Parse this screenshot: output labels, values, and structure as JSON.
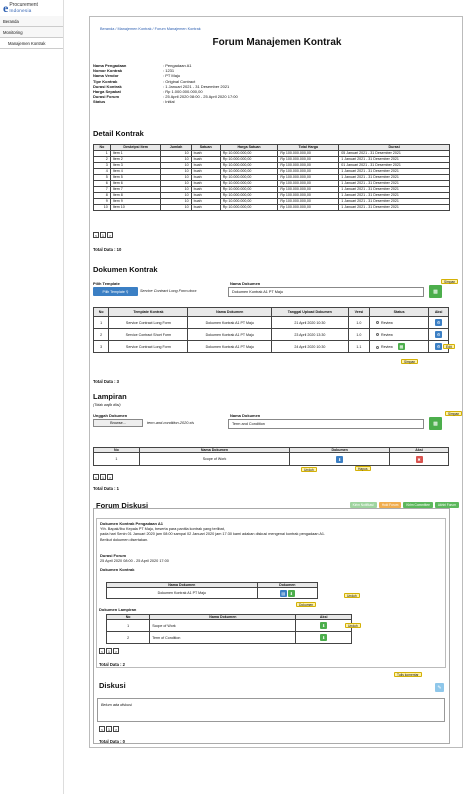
{
  "logo": {
    "mark": "e",
    "line1": "Procurement",
    "line2": "Indonesia"
  },
  "nav": [
    "Beranda",
    "Monitoring",
    "Manajemen Kontrak"
  ],
  "breadcrumb": "Beranda / Manajemen Kontrak / Forum Manajemen Kontrak",
  "page_title": "Forum Manajemen Kontrak",
  "info": [
    {
      "k": "Nama Pengadaan",
      "v": ": Pengadaan A1"
    },
    {
      "k": "Nomor Kontrak",
      "v": ": 1231"
    },
    {
      "k": "Nama Vendor",
      "v": ": PT Maju"
    },
    {
      "k": "Tipe Kontrak",
      "v": ": Original Contract"
    },
    {
      "k": "Durasi Kontrak",
      "v": ": 1 Januari 2021 - 31 Desember 2021"
    },
    {
      "k": "Harga Sepakat",
      "v": ": Rp 1.000.000.000,00"
    },
    {
      "k": "Durasi Forum",
      "v": ": 25 April 2020 08:00 - 25 April 2020 17:00"
    },
    {
      "k": "Status",
      "v": ": Initial"
    }
  ],
  "detail": {
    "title": "Detail Kontrak",
    "headers": [
      "No",
      "Deskripsi Item",
      "Jumlah",
      "Satuan",
      "Harga Satuan",
      "Total Harga",
      "Durasi"
    ],
    "rows": [
      [
        "1",
        "Item 1",
        "10",
        "buah",
        "Rp 10.000.000,00",
        "Rp 100.000.000,00",
        "05 Januari 2021 - 31 Desember 2021"
      ],
      [
        "2",
        "Item 2",
        "10",
        "buah",
        "Rp 10.000.000,00",
        "Rp 100.000.000,00",
        "1 Januari 2021 - 31 Desember 2021"
      ],
      [
        "3",
        "Item 3",
        "10",
        "buah",
        "Rp 10.000.000,00",
        "Rp 100.000.000,00",
        "01 Januari 2021 - 31 Desember 2021"
      ],
      [
        "4",
        "Item 4",
        "10",
        "buah",
        "Rp 10.000.000,00",
        "Rp 100.000.000,00",
        "1 Januari 2021 - 31 Desember 2021"
      ],
      [
        "5",
        "Item 5",
        "10",
        "buah",
        "Rp 10.000.000,00",
        "Rp 100.000.000,00",
        "1 Januari 2021 - 31 Desember 2021"
      ],
      [
        "6",
        "Item 6",
        "10",
        "buah",
        "Rp 10.000.000,00",
        "Rp 100.000.000,00",
        "1 Januari 2021 - 31 Desember 2021"
      ],
      [
        "7",
        "Item 7",
        "10",
        "buah",
        "Rp 10.000.000,00",
        "Rp 100.000.000,00",
        "1 Januari 2021 - 31 Desember 2021"
      ],
      [
        "8",
        "Item 8",
        "10",
        "buah",
        "Rp 10.000.000,00",
        "Rp 100.000.000,00",
        "1 Januari 2021 - 31 Desember 2021"
      ],
      [
        "9",
        "Item 9",
        "10",
        "buah",
        "Rp 10.000.000,00",
        "Rp 100.000.000,00",
        "1 Januari 2021 - 31 Desember 2021"
      ],
      [
        "10",
        "Item 10",
        "10",
        "buah",
        "Rp 10.000.000,00",
        "Rp 100.000.000,00",
        "1 Januari 2021 - 31 Desember 2021"
      ]
    ],
    "total": "Total Data : 10"
  },
  "pager": {
    "prev": "<",
    "page": "1",
    "next": ">"
  },
  "dokumen": {
    "title": "Dokumen Kontrak",
    "template_label": "Pilih Template",
    "template_btn": "Pilih Template",
    "template_value": "Service Contract Long Form.docx",
    "nama_label": "Nama Dokumen",
    "nama_value": "Dokumen Kontrak A1 PT Maju",
    "tip_simpan": "Simpan",
    "tip_edit": "Edit",
    "tip_simpan2": "Simpan",
    "headers": [
      "No",
      "Template Kontrak",
      "Nama Dokumen",
      "Tanggal Upload Dokumen",
      "Versi",
      "Status",
      "Aksi"
    ],
    "rows": [
      [
        "1",
        "Service Contract Long Form",
        "Dokumen Kontrak A1 PT Maju",
        "21 April 2020 10:30",
        "1.0",
        "Review"
      ],
      [
        "2",
        "Service Contract Short Form",
        "Dokumen Kontrak A1 PT Maju",
        "23 April 2020 13:30",
        "1.0",
        "Review"
      ],
      [
        "3",
        "Service Contract Long Form",
        "Dokumen Kontrak A1 PT Maju",
        "24 April 2020 10:30",
        "1.1",
        "Review"
      ]
    ],
    "total": "Total Data : 3"
  },
  "lampiran": {
    "title": "Lampiran",
    "subtitle": "(Tidak wajib diisi)",
    "upload_label": "Unggah Dokumen",
    "browse_btn": "Browse...",
    "file_value": "term-and-condition-2020.xls",
    "nama_label": "Nama Dokumen",
    "nama_value": "Term and Condition",
    "tip_simpan": "Simpan",
    "tip_unduh": "Unduh",
    "tip_hapus": "Hapus",
    "headers": [
      "No",
      "Nama Dokumen",
      "Dokumen",
      "Aksi"
    ],
    "rows": [
      [
        "1",
        "Scope of Work"
      ]
    ],
    "total": "Total Data : 1"
  },
  "forum": {
    "title": "Forum Diskusi",
    "buttons": [
      {
        "label": "Kirim Notifikasi",
        "color": "#9fd49f"
      },
      {
        "label": "Hold Forum",
        "color": "#f0ad4e"
      },
      {
        "label": "Kirim Committee",
        "color": "#5cb85c"
      },
      {
        "label": "Akhiri Forum",
        "color": "#5cb85c"
      }
    ],
    "announce_title": "Dokumen Kontrak Pengadaan A1",
    "announce_lines": [
      "Yth. Bapak/Ibu Kepala PT Maju, beserta para panitia kontrak yang terlibat,",
      "pada hari Senin 01 Januari 2020 jam 08:00 sampai 02 Januari 2020 jam 17:30 kami adakan diskusi mengenai kontrak pengadaan A1.",
      "Berikut dokumen disertakan."
    ],
    "durasi_label": "Durasi Forum",
    "durasi_value": "25 April 2020 08:00 - 25 April 2020 17:00",
    "dk_label": "Dokumen Kontrak",
    "dk_headers": [
      "Nama Dokumen",
      "Dokumen"
    ],
    "dk_rows": [
      [
        "Dokumen Kontrak A1 PT Maju"
      ]
    ],
    "tip_dokumen": "Dokumen",
    "tip_unduh": "Unduh",
    "dl_label": "Dokumen Lampiran",
    "dl_headers": [
      "No",
      "Nama Dokumen",
      "Aksi"
    ],
    "dl_rows": [
      [
        "1",
        "Scope of Work"
      ],
      [
        "2",
        "Term of Condition"
      ]
    ],
    "tip_unduh2": "Unduh",
    "total": "Total Data : 2",
    "diskusi_title": "Diskusi",
    "tip_tulis": "Tulis komentar",
    "placeholder": "Belum ada diskusi",
    "diskusi_total": "Total Data : 0"
  },
  "colors": {
    "blue": "#3b7fc4",
    "green": "#4cae4c",
    "red": "#d9534f"
  }
}
